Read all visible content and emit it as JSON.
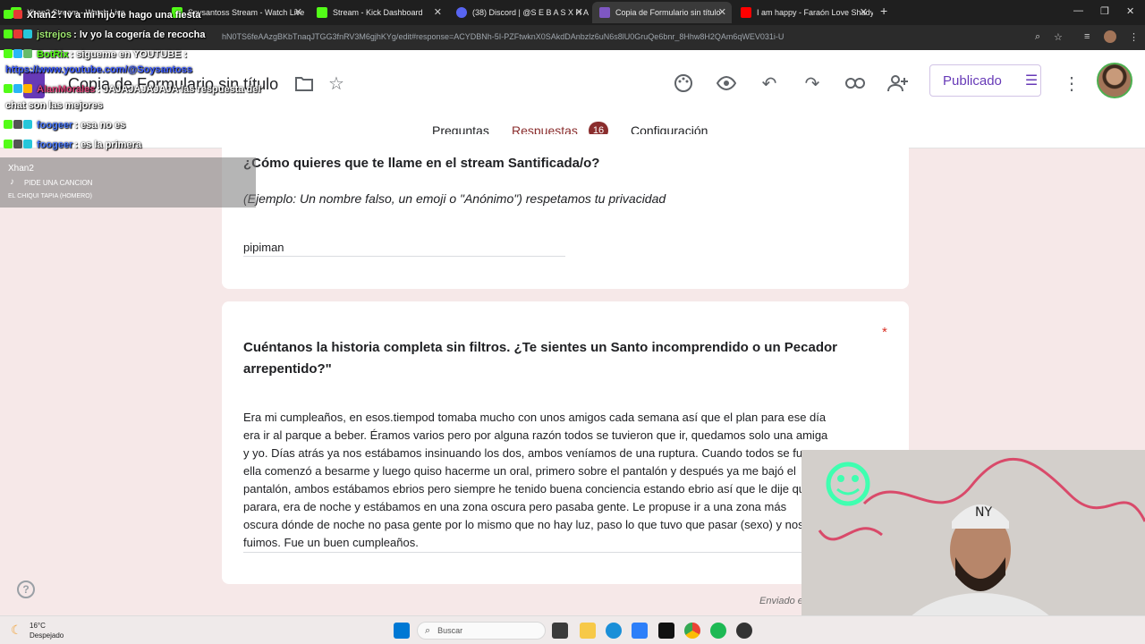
{
  "browser": {
    "tabs": [
      {
        "title": "Xhan2 Stream - Watch Live",
        "fav_color": "#53fc18"
      },
      {
        "title": "Soysantoss Stream - Watch Live",
        "fav_color": "#53fc18"
      },
      {
        "title": "Stream - Kick Dashboard",
        "fav_color": "#53fc18"
      },
      {
        "title": "(38) Discord | @S E B A S X H A",
        "fav_color": "#5865f2"
      },
      {
        "title": "Copia de Formulario sin título",
        "fav_color": "#7e57c2"
      },
      {
        "title": "I am happy - Faraón Love Shady",
        "fav_color": "#ff0000"
      }
    ],
    "url": "hN0TS6feAAzgBKbTnaqJTGG3fnRV3M6gjhKYg/edit#response=ACYDBNh-5I-PZFtwknX0SAkdDAnbzlz6uN6s8lU0GruQe6bnr_8Hhw8H2QAm6qWEV031i-U"
  },
  "form": {
    "title": "Copia de Formulario sin título",
    "publish_label": "Publicado",
    "tabs": {
      "questions": "Preguntas",
      "responses": "Respuestas",
      "responses_count": "16",
      "settings": "Configuración"
    },
    "card1": {
      "question": "¿Cómo quieres que te llame en el stream Santificada/o?",
      "description": "(Ejemplo: Un nombre falso, un emoji o \"Anónimo\") respetamos tu privacidad",
      "answer": "pipiman"
    },
    "card2": {
      "question_line1": "Cuéntanos la historia completa sin filtros. ¿Te sientes un Santo incomprendido o un Pecador",
      "question_line2": "arrepentido?\"",
      "required_mark": "*",
      "answer_lines": [
        "Era mi cumpleaños, en esos.tiempod tomaba mucho con unos amigos cada semana así que el plan para ese día",
        "era ir al parque a beber. Éramos varios pero por alguna razón todos se tuvieron que ir, quedamos solo una amiga",
        "y yo. Días atrás ya nos estábamos insinuando los dos, ambos veníamos de una ruptura. Cuando todos se fueron",
        "ella comenzó a besarme y luego quiso hacerme un oral, primero sobre el pantalón y después ya me bajó el",
        "pantalón, ambos estábamos ebrios pero siempre he tenido buena conciencia estando ebrio así que le dije que",
        "parara, era de noche y estábamos en una zona oscura pero pasaba gente. Le propuse ir a una zona más",
        "oscura dónde de noche no pasa gente por lo mismo que no hay luz, paso lo que tuvo que pasar (sexo) y nos",
        "fuimos. Fue un buen cumpleaños."
      ],
      "footer_text": "Enviado el"
    },
    "help_label": "?"
  },
  "chat": [
    {
      "user": "Xhan2",
      "msg": ": lv a mi hijo le hago una fiesta",
      "user_color": "#ffffff"
    },
    {
      "user": "jstrejos",
      "msg": ": lv yo la cogería de recocha",
      "user_color": "#9fe870"
    },
    {
      "user": "BotRix",
      "msg": ": sigueme en YOUTUBE :",
      "user_color": "#53fc18"
    },
    {
      "user": "",
      "msg": "https://www.youtube.com/@Soysantoss",
      "user_color": "#3b5bff"
    },
    {
      "user": "AlanMorales",
      "msg": ": JAJAJAJAJAJA las respuesta del",
      "user_color": "#e0457b"
    },
    {
      "user": "",
      "msg": "chat son las mejores",
      "user_color": "#ffffff"
    },
    {
      "user": "foogeer",
      "msg": ": esa no es",
      "user_color": "#4b7bff"
    },
    {
      "user": "foogeer",
      "msg": ": es la primera",
      "user_color": "#4b7bff"
    }
  ],
  "now_playing": {
    "channel": "Xhan2",
    "label": "PIDE UNA CANCION",
    "artist": "EL CHIQUI TAPIA (HOMERO)"
  },
  "taskbar": {
    "temperature": "16°C",
    "weather": "Despejado",
    "search_label": "Buscar"
  }
}
